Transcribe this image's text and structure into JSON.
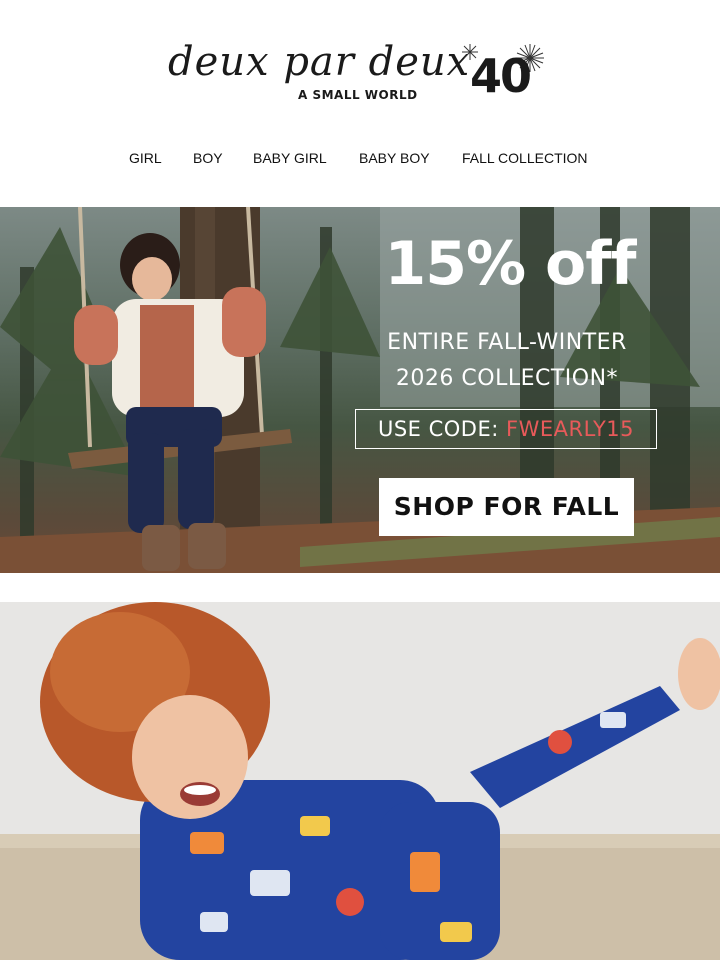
{
  "logo": {
    "brand": "deux par deux",
    "tagline": "A SMALL WORLD",
    "anniversary": "40"
  },
  "nav": {
    "items": [
      "GIRL",
      "BOY",
      "BABY GIRL",
      "BABY BOY",
      "FALL COLLECTION"
    ]
  },
  "hero": {
    "headline": "15% off",
    "sub_line1": "ENTIRE FALL-WINTER",
    "sub_line2": "2026 COLLECTION*",
    "code_label": "USE CODE: ",
    "code_value": "FWEARLY15",
    "cta_label": "SHOP FOR FALL"
  },
  "colors": {
    "code_accent": "#e85a5a",
    "cta_background": "#ffffff",
    "text_dark": "#111111"
  },
  "icons": [
    "fireworks-icon"
  ]
}
